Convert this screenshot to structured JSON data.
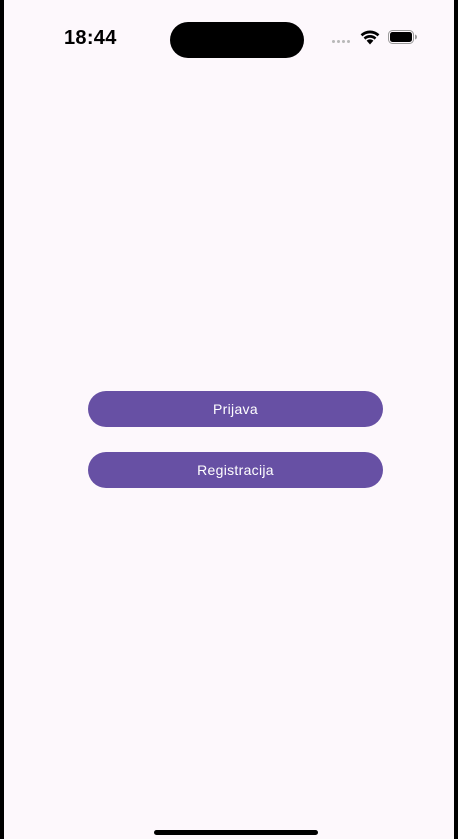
{
  "status_bar": {
    "time": "18:44",
    "icons": [
      "signal-dots-icon",
      "wifi-icon",
      "battery-icon"
    ]
  },
  "actions": {
    "login_label": "Prijava",
    "register_label": "Registracija"
  },
  "colors": {
    "background": "#fdf8fc",
    "button": "#6750a4",
    "button_text": "#ffffff",
    "frame": "#000000"
  }
}
